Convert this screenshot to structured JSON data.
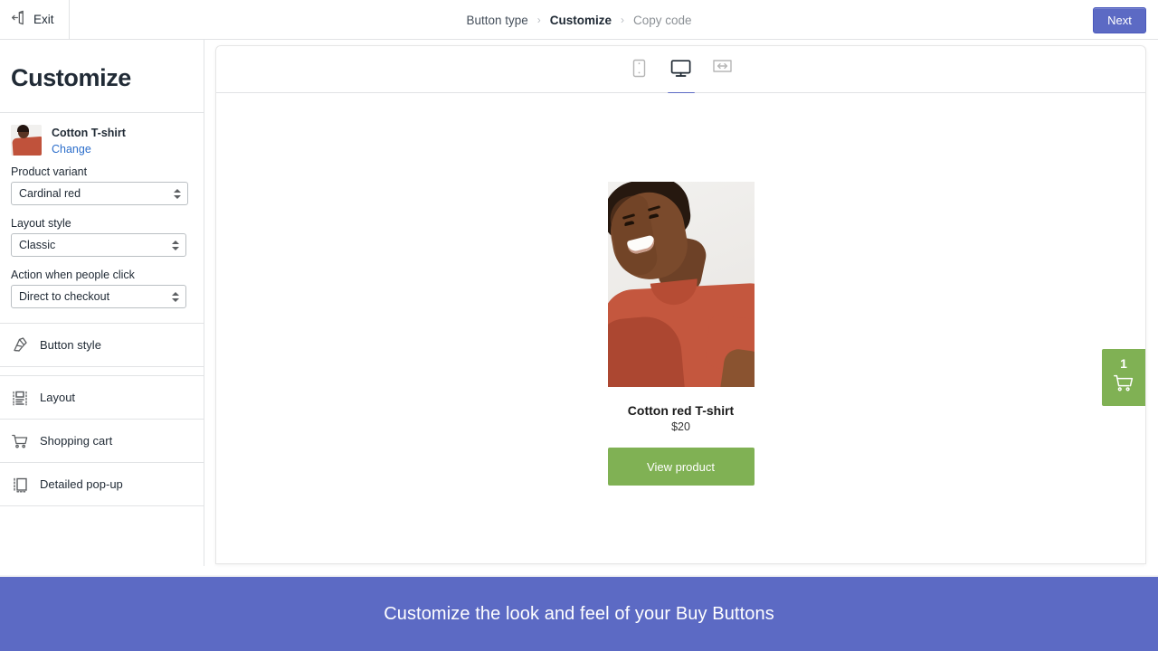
{
  "topbar": {
    "exit_label": "Exit",
    "exit_icon": "exit-door-icon",
    "next_label": "Next",
    "next_color": "#5C6AC4"
  },
  "breadcrumb": {
    "separator": "›",
    "items": [
      {
        "label": "Button type",
        "state": "completed"
      },
      {
        "label": "Customize",
        "state": "current"
      },
      {
        "label": "Copy code",
        "state": "upcoming"
      }
    ]
  },
  "sidebar": {
    "title": "Customize",
    "product": {
      "name": "Cotton T-shirt",
      "change_label": "Change",
      "thumbnail_alt": "cotton-t-shirt-thumbnail"
    },
    "fields": [
      {
        "label": "Product variant",
        "value": "Cardinal red"
      },
      {
        "label": "Layout style",
        "value": "Classic"
      },
      {
        "label": "Action when people click",
        "value": "Direct to checkout"
      }
    ],
    "menu": [
      {
        "label": "Button style",
        "icon": "paint-roller-icon"
      },
      {
        "label": "Layout",
        "icon": "layout-grid-icon"
      },
      {
        "label": "Shopping cart",
        "icon": "shopping-cart-icon"
      },
      {
        "label": "Detailed pop-up",
        "icon": "popup-window-icon"
      }
    ]
  },
  "preview": {
    "devices": [
      {
        "name": "mobile",
        "icon": "mobile-icon",
        "active": false
      },
      {
        "name": "desktop",
        "icon": "desktop-icon",
        "active": true
      },
      {
        "name": "full-width",
        "icon": "full-width-icon",
        "active": false
      }
    ],
    "product": {
      "title": "Cotton red T-shirt",
      "price": "$20",
      "button_label": "View product",
      "button_color": "#80B154",
      "image_alt": "woman-wearing-cardinal-red-t-shirt"
    },
    "cart": {
      "count": "1",
      "icon": "shopping-cart-icon",
      "color": "#80B154"
    }
  },
  "footer": {
    "text": "Customize the look and feel of your Buy Buttons",
    "background": "#5C6AC4"
  }
}
